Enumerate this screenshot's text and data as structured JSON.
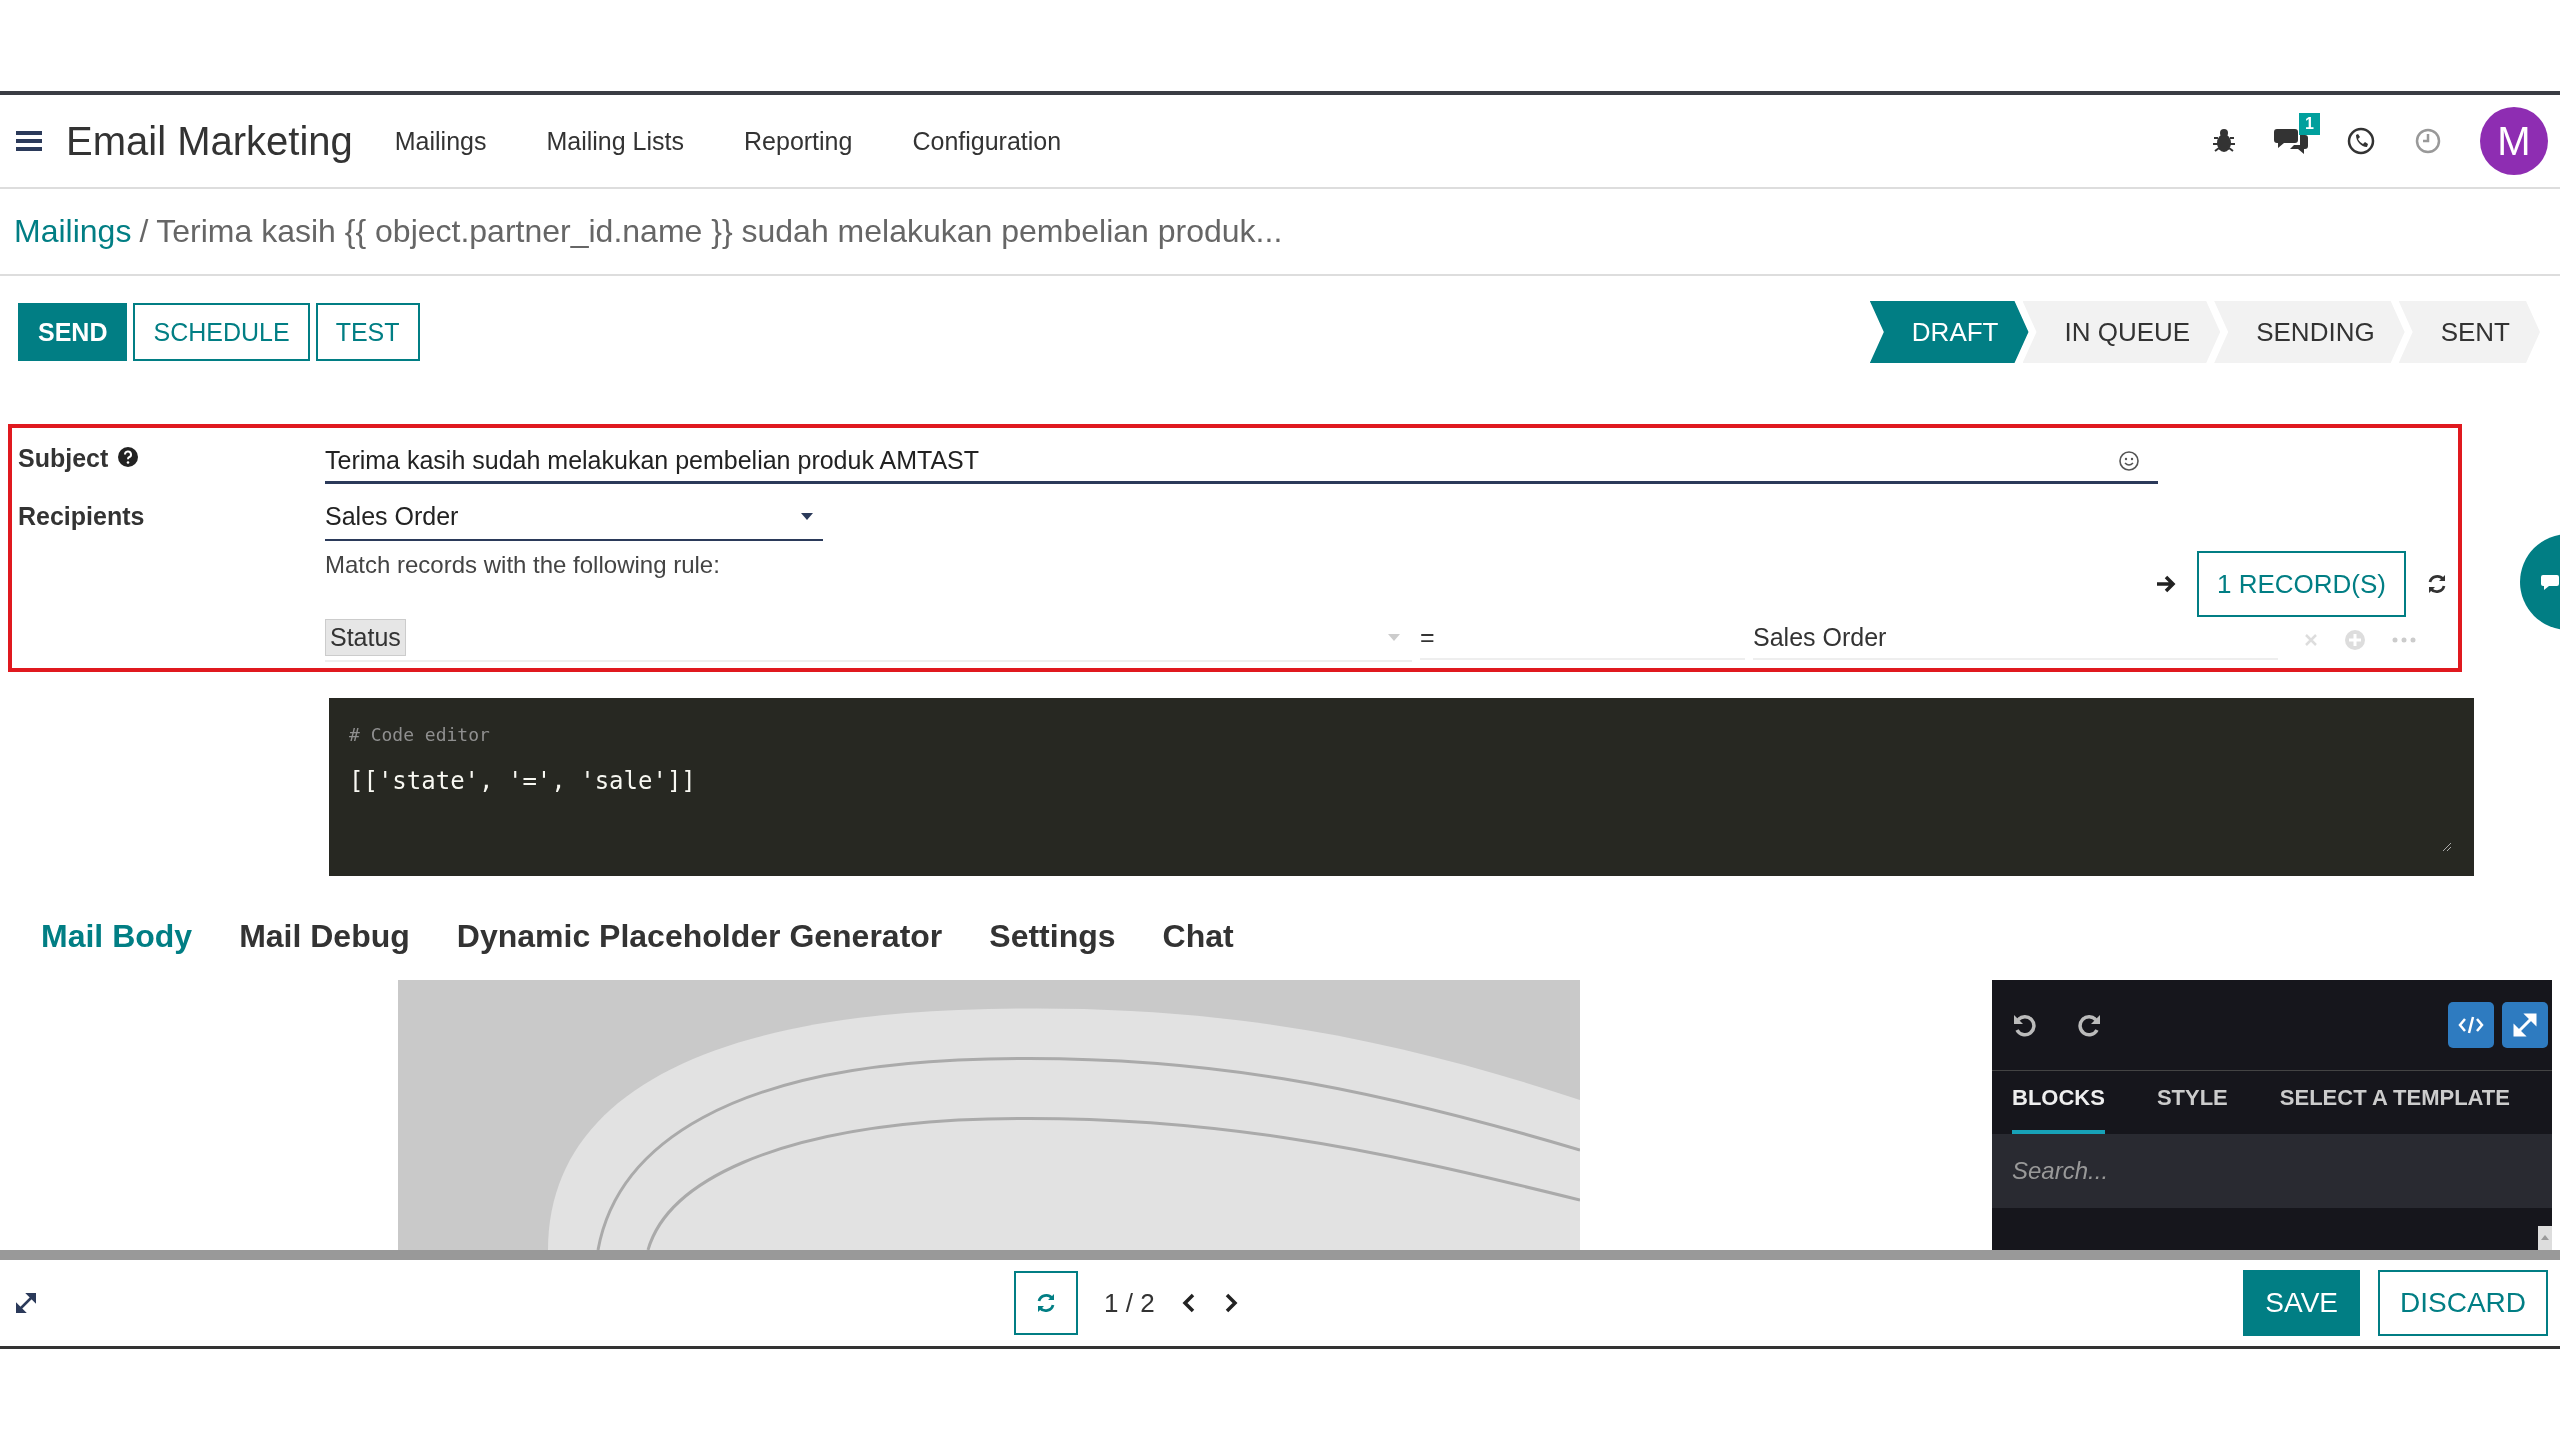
{
  "navbar": {
    "app_title": "Email Marketing",
    "menu": [
      "Mailings",
      "Mailing Lists",
      "Reporting",
      "Configuration"
    ],
    "chat_badge": "1",
    "avatar_letter": "M"
  },
  "breadcrumb": {
    "parent": "Mailings",
    "separator": "/",
    "current": "Terima kasih {{ object.partner_id.name }} sudah melakukan pembelian produk..."
  },
  "actions": [
    {
      "label": "SEND",
      "kind": "primary"
    },
    {
      "label": "SCHEDULE",
      "kind": "secondary"
    },
    {
      "label": "TEST",
      "kind": "secondary"
    }
  ],
  "stages": [
    {
      "label": "DRAFT",
      "selected": true
    },
    {
      "label": "IN QUEUE",
      "selected": false
    },
    {
      "label": "SENDING",
      "selected": false
    },
    {
      "label": "SENT",
      "selected": false
    }
  ],
  "form": {
    "subject_label": "Subject",
    "subject_value": "Terima kasih sudah melakukan pembelian produk AMTAST",
    "recipients_label": "Recipients",
    "recipients_value": "Sales Order",
    "rule_hint": "Match records with the following rule:",
    "records_button": "1 RECORD(S)",
    "rule": {
      "field": "Status",
      "operator": "=",
      "value": "Sales Order"
    }
  },
  "code_editor": {
    "comment": "# Code editor",
    "code": "[['state', '=', 'sale']]"
  },
  "tabs": [
    {
      "label": "Mail Body",
      "selected": true
    },
    {
      "label": "Mail Debug",
      "selected": false
    },
    {
      "label": "Dynamic Placeholder Generator",
      "selected": false
    },
    {
      "label": "Settings",
      "selected": false
    },
    {
      "label": "Chat",
      "selected": false
    }
  ],
  "builder": {
    "tabs": [
      {
        "label": "BLOCKS",
        "selected": true
      },
      {
        "label": "STYLE",
        "selected": false
      },
      {
        "label": "SELECT A TEMPLATE",
        "selected": false
      }
    ],
    "search_placeholder": "Search..."
  },
  "footer": {
    "pager": "1 / 2",
    "save": "SAVE",
    "discard": "DISCARD"
  }
}
